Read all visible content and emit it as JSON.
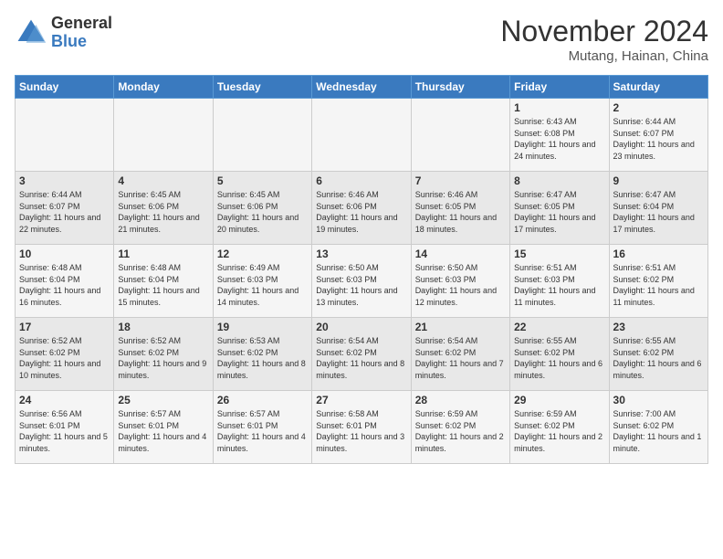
{
  "logo": {
    "general": "General",
    "blue": "Blue"
  },
  "title": "November 2024",
  "location": "Mutang, Hainan, China",
  "days_of_week": [
    "Sunday",
    "Monday",
    "Tuesday",
    "Wednesday",
    "Thursday",
    "Friday",
    "Saturday"
  ],
  "weeks": [
    [
      {
        "num": "",
        "info": ""
      },
      {
        "num": "",
        "info": ""
      },
      {
        "num": "",
        "info": ""
      },
      {
        "num": "",
        "info": ""
      },
      {
        "num": "",
        "info": ""
      },
      {
        "num": "1",
        "info": "Sunrise: 6:43 AM\nSunset: 6:08 PM\nDaylight: 11 hours and 24 minutes."
      },
      {
        "num": "2",
        "info": "Sunrise: 6:44 AM\nSunset: 6:07 PM\nDaylight: 11 hours and 23 minutes."
      }
    ],
    [
      {
        "num": "3",
        "info": "Sunrise: 6:44 AM\nSunset: 6:07 PM\nDaylight: 11 hours and 22 minutes."
      },
      {
        "num": "4",
        "info": "Sunrise: 6:45 AM\nSunset: 6:06 PM\nDaylight: 11 hours and 21 minutes."
      },
      {
        "num": "5",
        "info": "Sunrise: 6:45 AM\nSunset: 6:06 PM\nDaylight: 11 hours and 20 minutes."
      },
      {
        "num": "6",
        "info": "Sunrise: 6:46 AM\nSunset: 6:06 PM\nDaylight: 11 hours and 19 minutes."
      },
      {
        "num": "7",
        "info": "Sunrise: 6:46 AM\nSunset: 6:05 PM\nDaylight: 11 hours and 18 minutes."
      },
      {
        "num": "8",
        "info": "Sunrise: 6:47 AM\nSunset: 6:05 PM\nDaylight: 11 hours and 17 minutes."
      },
      {
        "num": "9",
        "info": "Sunrise: 6:47 AM\nSunset: 6:04 PM\nDaylight: 11 hours and 17 minutes."
      }
    ],
    [
      {
        "num": "10",
        "info": "Sunrise: 6:48 AM\nSunset: 6:04 PM\nDaylight: 11 hours and 16 minutes."
      },
      {
        "num": "11",
        "info": "Sunrise: 6:48 AM\nSunset: 6:04 PM\nDaylight: 11 hours and 15 minutes."
      },
      {
        "num": "12",
        "info": "Sunrise: 6:49 AM\nSunset: 6:03 PM\nDaylight: 11 hours and 14 minutes."
      },
      {
        "num": "13",
        "info": "Sunrise: 6:50 AM\nSunset: 6:03 PM\nDaylight: 11 hours and 13 minutes."
      },
      {
        "num": "14",
        "info": "Sunrise: 6:50 AM\nSunset: 6:03 PM\nDaylight: 11 hours and 12 minutes."
      },
      {
        "num": "15",
        "info": "Sunrise: 6:51 AM\nSunset: 6:03 PM\nDaylight: 11 hours and 11 minutes."
      },
      {
        "num": "16",
        "info": "Sunrise: 6:51 AM\nSunset: 6:02 PM\nDaylight: 11 hours and 11 minutes."
      }
    ],
    [
      {
        "num": "17",
        "info": "Sunrise: 6:52 AM\nSunset: 6:02 PM\nDaylight: 11 hours and 10 minutes."
      },
      {
        "num": "18",
        "info": "Sunrise: 6:52 AM\nSunset: 6:02 PM\nDaylight: 11 hours and 9 minutes."
      },
      {
        "num": "19",
        "info": "Sunrise: 6:53 AM\nSunset: 6:02 PM\nDaylight: 11 hours and 8 minutes."
      },
      {
        "num": "20",
        "info": "Sunrise: 6:54 AM\nSunset: 6:02 PM\nDaylight: 11 hours and 8 minutes."
      },
      {
        "num": "21",
        "info": "Sunrise: 6:54 AM\nSunset: 6:02 PM\nDaylight: 11 hours and 7 minutes."
      },
      {
        "num": "22",
        "info": "Sunrise: 6:55 AM\nSunset: 6:02 PM\nDaylight: 11 hours and 6 minutes."
      },
      {
        "num": "23",
        "info": "Sunrise: 6:55 AM\nSunset: 6:02 PM\nDaylight: 11 hours and 6 minutes."
      }
    ],
    [
      {
        "num": "24",
        "info": "Sunrise: 6:56 AM\nSunset: 6:01 PM\nDaylight: 11 hours and 5 minutes."
      },
      {
        "num": "25",
        "info": "Sunrise: 6:57 AM\nSunset: 6:01 PM\nDaylight: 11 hours and 4 minutes."
      },
      {
        "num": "26",
        "info": "Sunrise: 6:57 AM\nSunset: 6:01 PM\nDaylight: 11 hours and 4 minutes."
      },
      {
        "num": "27",
        "info": "Sunrise: 6:58 AM\nSunset: 6:01 PM\nDaylight: 11 hours and 3 minutes."
      },
      {
        "num": "28",
        "info": "Sunrise: 6:59 AM\nSunset: 6:02 PM\nDaylight: 11 hours and 2 minutes."
      },
      {
        "num": "29",
        "info": "Sunrise: 6:59 AM\nSunset: 6:02 PM\nDaylight: 11 hours and 2 minutes."
      },
      {
        "num": "30",
        "info": "Sunrise: 7:00 AM\nSunset: 6:02 PM\nDaylight: 11 hours and 1 minute."
      }
    ]
  ]
}
